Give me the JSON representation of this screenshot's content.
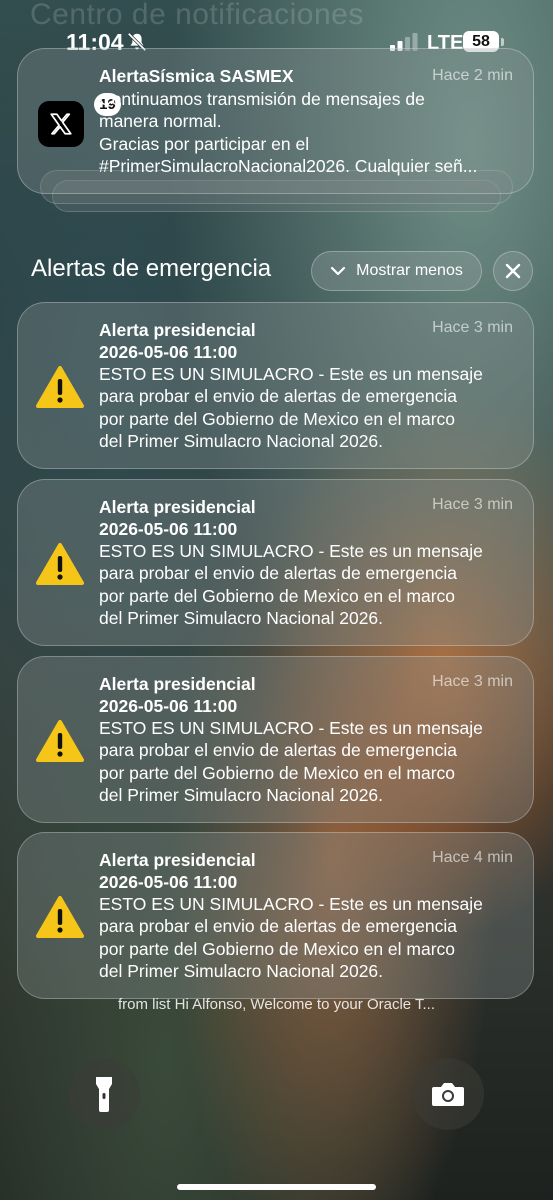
{
  "background_ghost_text": "Centro de notificaciones",
  "status_bar": {
    "time": "11:04",
    "network": "LTE",
    "battery": "58"
  },
  "x_notification": {
    "badge": "19",
    "title": "AlertaSísmica SASMEX",
    "time": "Hace 2 min",
    "lines": [
      "Continuamos transmisión de mensajes de",
      "manera normal.",
      "Gracias por participar en el",
      "#PrimerSimulacroNacional2026. Cualquier señ..."
    ]
  },
  "emergency_section": {
    "title": "Alertas de emergencia",
    "show_less_label": "Mostrar menos"
  },
  "alerts": [
    {
      "title": "Alerta presidencial",
      "date": "2026-05-06 11:00",
      "time": "Hace 3 min",
      "lines": [
        "ESTO ES UN SIMULACRO - Este es un mensaje",
        "para probar el envio de alertas de emergencia",
        "por parte del Gobierno de Mexico en el marco",
        "del Primer Simulacro Nacional 2026."
      ]
    },
    {
      "title": "Alerta presidencial",
      "date": "2026-05-06 11:00",
      "time": "Hace 3 min",
      "lines": [
        "ESTO ES UN SIMULACRO - Este es un mensaje",
        "para probar el envio de alertas de emergencia",
        "por parte del Gobierno de Mexico en el marco",
        "del Primer Simulacro Nacional 2026."
      ]
    },
    {
      "title": "Alerta presidencial",
      "date": "2026-05-06 11:00",
      "time": "Hace 3 min",
      "lines": [
        "ESTO ES UN SIMULACRO - Este es un mensaje",
        "para probar el envio de alertas de emergencia",
        "por parte del Gobierno de Mexico en el marco",
        "del Primer Simulacro Nacional 2026."
      ]
    },
    {
      "title": "Alerta presidencial",
      "date": "2026-05-06 11:00",
      "time": "Hace 4 min",
      "lines": [
        "ESTO ES UN SIMULACRO - Este es un mensaje",
        "para probar el envio de alertas de emergencia",
        "por parte del Gobierno de Mexico en el marco",
        "del Primer Simulacro Nacional 2026."
      ]
    }
  ],
  "peek_text": "from list Hi Alfonso, Welcome to your Oracle T...",
  "icons": {
    "status": [
      "mute-bell-icon",
      "cellular-signal-icon"
    ],
    "app": "x-logo-icon",
    "alert": "warning-triangle-icon",
    "controls": [
      "chevron-down-icon",
      "close-icon",
      "flashlight-icon",
      "camera-icon"
    ]
  },
  "colors": {
    "warning_yellow": "#f5c518",
    "card_bg": "#8c9696"
  }
}
